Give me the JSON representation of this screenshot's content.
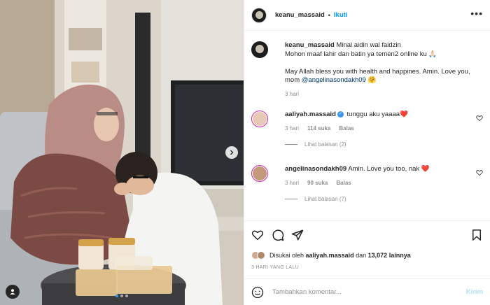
{
  "photo": {
    "alt_icons": {
      "next": "chevron-right-icon",
      "tag": "user-tag-icon"
    },
    "carousel": {
      "count": 3,
      "active_index": 0
    }
  },
  "header": {
    "username": "keanu_massaid",
    "separator": "•",
    "follow_label": "Ikuti",
    "more_icon": "more-horizontal-icon"
  },
  "caption": {
    "username": "keanu_massaid",
    "line1": "Minal aidin wal faidzin",
    "line2": "Mohon maaf lahir dan batin ya temen2 online ku 🙏🏻",
    "line3": "May Allah bless you with health and happines. Amin. Love you, mom",
    "mention": "@angelinasondakh09",
    "emoji": "🤗",
    "time": "3 hari"
  },
  "comments": [
    {
      "username": "aaliyah.massaid",
      "verified": true,
      "text": "tunggu aku yaaaa❤️",
      "time": "3 hari",
      "likes": "114 suka",
      "reply_label": "Balas",
      "view_replies": "Lihat balasan (2)"
    },
    {
      "username": "angelinasondakh09",
      "verified": false,
      "text": "Amin. Love you too, nak ❤️",
      "time": "3 hari",
      "likes": "90 suka",
      "reply_label": "Balas",
      "view_replies": "Lihat balasan (7)"
    }
  ],
  "actions": {
    "icons": [
      "heart-icon",
      "comment-icon",
      "share-icon",
      "bookmark-icon"
    ]
  },
  "likes": {
    "prefix": "Disukai oleh",
    "user": "aaliyah.massaid",
    "middle": "dan",
    "count": "13,072",
    "suffix": "lainnya"
  },
  "date": "3 HARI YANG LALU",
  "comment_box": {
    "placeholder": "Tambahkan komentar...",
    "post_label": "Kirim"
  },
  "colors": {
    "accent": "#0095f6",
    "mention": "#00376b",
    "muted": "#8e8e8e",
    "heart": "#ed4956",
    "post_disabled": "#b2dffc"
  }
}
